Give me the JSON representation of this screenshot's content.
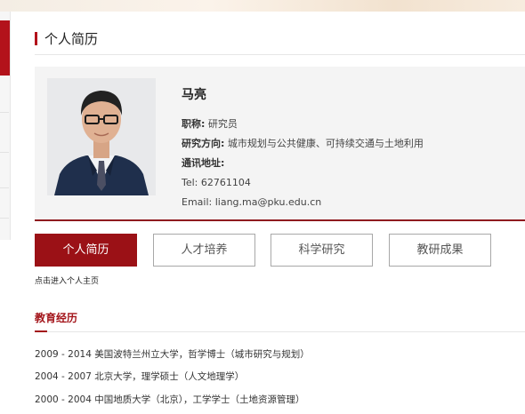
{
  "section_title": "个人简历",
  "profile": {
    "name": "马亮",
    "title_label": "职称:",
    "title_value": "研究员",
    "research_label": "研究方向:",
    "research_value": "城市规划与公共健康、可持续交通与土地利用",
    "address_label": "通讯地址:",
    "address_value": "",
    "tel_label": "Tel:",
    "tel_value": "62761104",
    "email_label": "Email:",
    "email_value": "liang.ma@pku.edu.cn"
  },
  "tabs": [
    {
      "label": "个人简历",
      "active": true
    },
    {
      "label": "人才培养",
      "active": false
    },
    {
      "label": "科学研究",
      "active": false
    },
    {
      "label": "教研成果",
      "active": false
    }
  ],
  "enter_homepage_link": "点击进入个人主页",
  "education": {
    "heading": "教育经历",
    "items": [
      "2009 - 2014 美国波特兰州立大学，哲学博士（城市研究与规划）",
      "2004 - 2007 北京大学，理学硕士（人文地理学）",
      "2000 - 2004 中国地质大学（北京），工学学士（土地资源管理）"
    ]
  },
  "colors": {
    "accent": "#9b1116",
    "heading_red": "#a3141a",
    "card_bg": "#f4f4f4"
  }
}
